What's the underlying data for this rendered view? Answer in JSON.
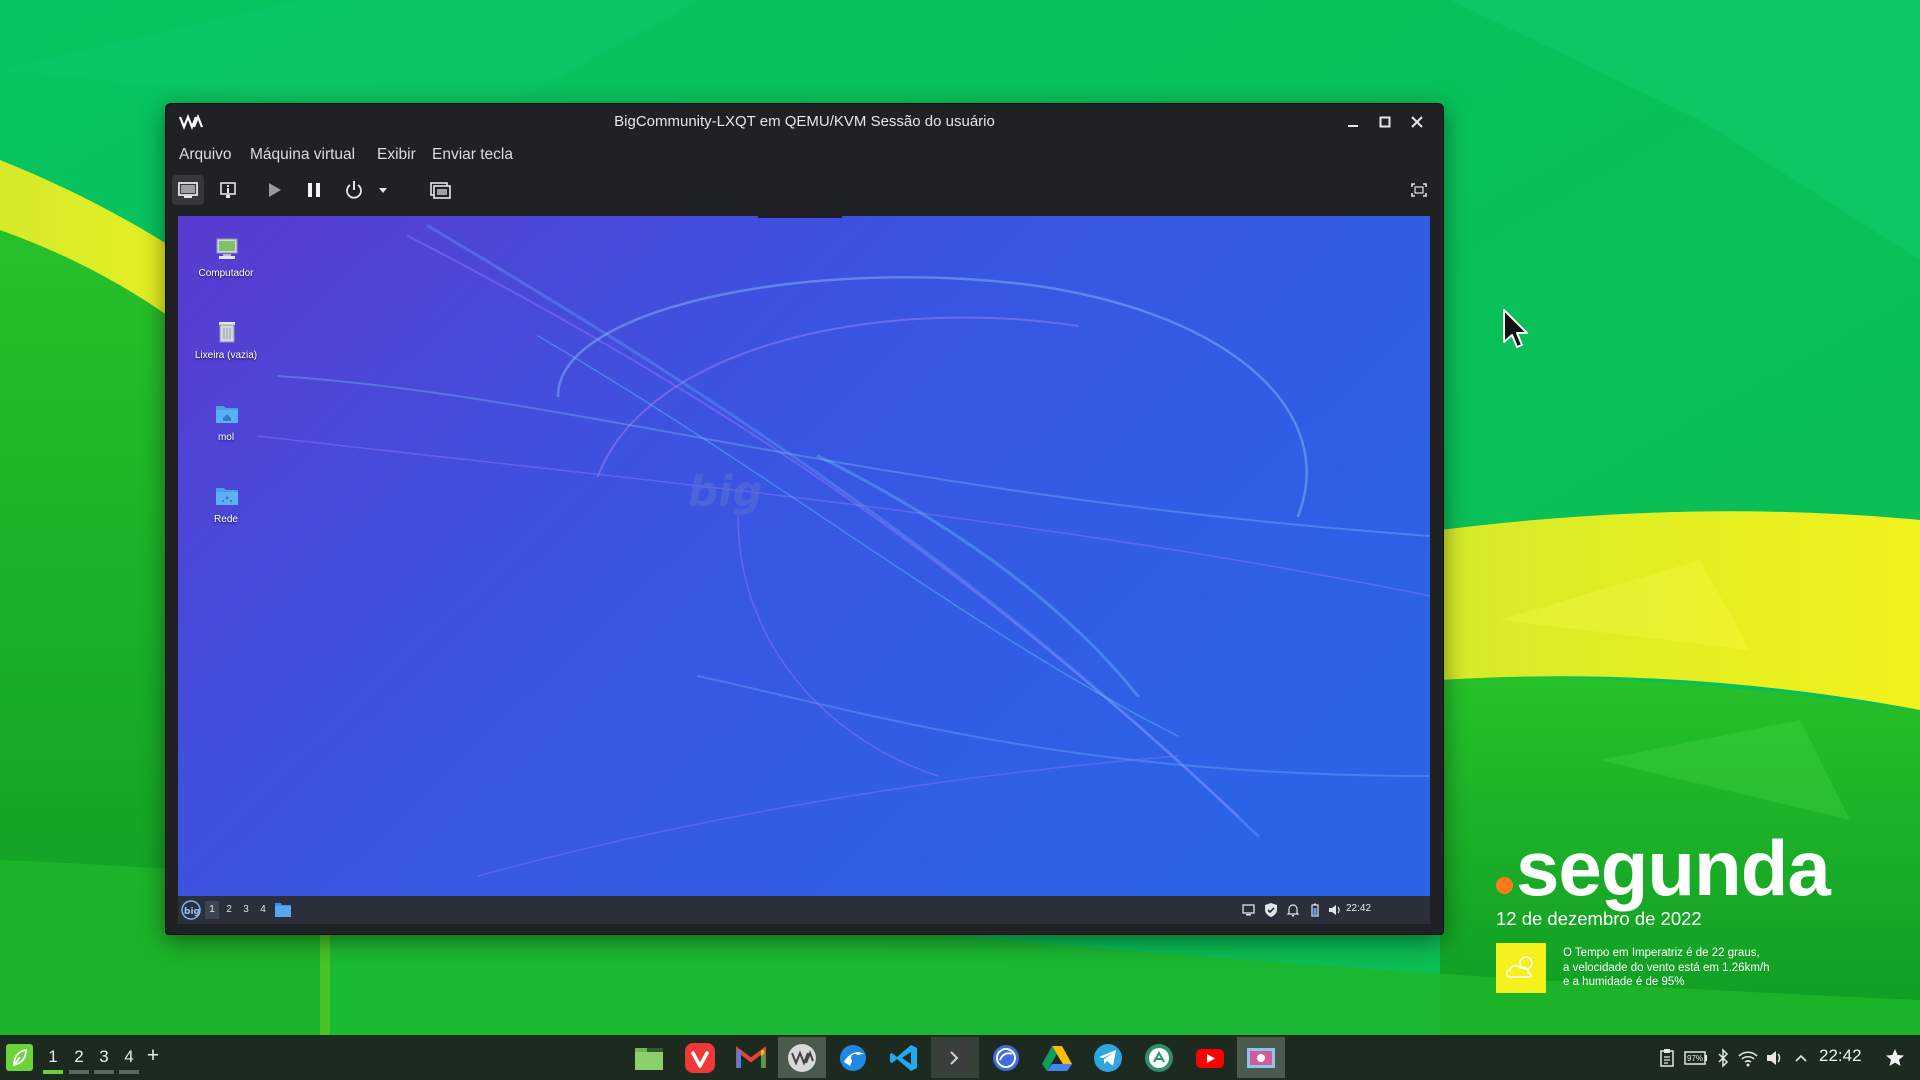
{
  "window": {
    "title": "BigCommunity-LXQT em QEMU/KVM Sessão do usuário",
    "menu": [
      "Arquivo",
      "Máquina virtual",
      "Exibir",
      "Enviar tecla"
    ]
  },
  "guest": {
    "desktop_icons": [
      "Computador",
      "Lixeira (vazia)",
      "mol",
      "Rede"
    ],
    "workspaces": [
      "1",
      "2",
      "3",
      "4"
    ],
    "clock": "22:42"
  },
  "widget": {
    "day": "segunda",
    "date": "12 de dezembro de 2022",
    "weather_lines": [
      "O Tempo em Imperatriz é de 22 graus,",
      "a velocidade do vento está em 1.26km/h",
      "e a humidade é de 95%"
    ]
  },
  "taskbar": {
    "workspaces": [
      "1",
      "2",
      "3",
      "4"
    ],
    "add_label": "+",
    "battery": "97%",
    "clock": "22:42",
    "dock_apps": [
      "file-manager-icon",
      "vivaldi-icon",
      "gmail-icon",
      "virt-manager-icon",
      "browser-icon",
      "vscode-icon",
      "terminal-icon",
      "compass-icon",
      "google-drive-icon",
      "telegram-icon",
      "system-icon",
      "youtube-icon",
      "screenshot-icon"
    ]
  },
  "colors": {
    "host_green": "#0fc45a",
    "host_yellow": "#f0f11c",
    "guest_blue": "#4a4bd6",
    "accent_orange": "#ff7a1a"
  }
}
